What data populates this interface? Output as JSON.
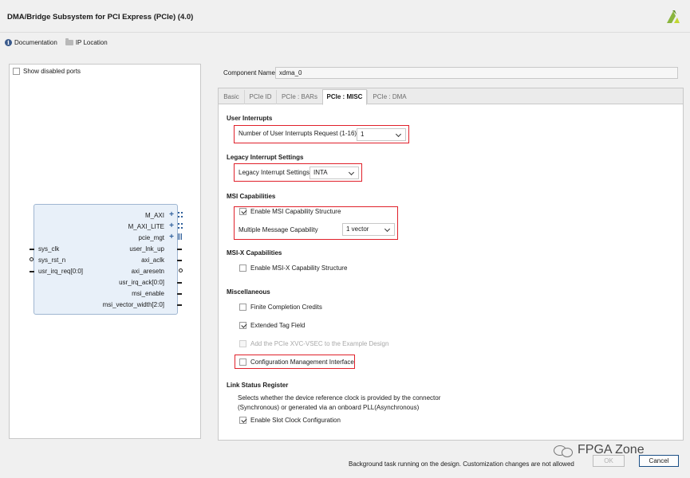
{
  "window": {
    "title": "DMA/Bridge Subsystem for PCI Express (PCIe) (4.0)",
    "logo_icon": "xilinx-logo-icon"
  },
  "links": {
    "documentation": "Documentation",
    "ip_location": "IP Location"
  },
  "left_panel": {
    "show_disabled_ports": "Show disabled ports",
    "right_ports": [
      "M_AXI",
      "M_AXI_LITE",
      "pcie_mgt",
      "user_lnk_up",
      "axi_aclk",
      "axi_aresetn",
      "usr_irq_ack[0:0]",
      "msi_enable",
      "msi_vector_width[2:0]"
    ],
    "left_ports": [
      "sys_clk",
      "sys_rst_n",
      "usr_irq_req[0:0]"
    ]
  },
  "component": {
    "label": "Component Name",
    "value": "xdma_0"
  },
  "tabs": [
    {
      "label": "Basic"
    },
    {
      "label": "PCIe ID"
    },
    {
      "label": "PCIe : BARs"
    },
    {
      "label": "PCIe : MISC",
      "active": true
    },
    {
      "label": "PCIe : DMA"
    }
  ],
  "misc": {
    "user_interrupts": {
      "heading": "User Interrupts",
      "label": "Number of User Interrupts Request (1-16)",
      "value": "1"
    },
    "legacy": {
      "heading": "Legacy Interrupt Settings",
      "label": "Legacy Interrupt Settings",
      "value": "INTA"
    },
    "msi": {
      "heading": "MSI Capabilities",
      "enable_label": "Enable MSI Capability Structure",
      "enable_checked": true,
      "mmc_label": "Multiple Message Capability",
      "mmc_value": "1 vector"
    },
    "msix": {
      "heading": "MSI-X Capabilities",
      "enable_label": "Enable MSI-X Capability Structure",
      "enable_checked": false
    },
    "misc_section": {
      "heading": "Miscellaneous",
      "finite_label": "Finite Completion Credits",
      "finite_checked": false,
      "ext_tag_label": "Extended Tag Field",
      "ext_tag_checked": true,
      "xvc_label": "Add the PCIe XVC-VSEC to the Example Design",
      "xvc_checked": false,
      "cfg_mgmt_label": "Configuration Management Interface",
      "cfg_mgmt_checked": false
    },
    "link_status": {
      "heading": "Link Status Register",
      "desc_line1": "Selects whether the device reference clock is provided by the connector",
      "desc_line2": "(Synchronous) or generated via an onboard PLL(Asynchronous)",
      "slot_clock_label": "Enable Slot Clock Configuration",
      "slot_clock_checked": true
    }
  },
  "footer": {
    "status": "Background task running on the design. Customization changes are not allowed",
    "ok": "OK",
    "cancel": "Cancel"
  },
  "watermark": {
    "text": "FPGA Zone"
  },
  "colors": {
    "highlight_box": "#e0202a",
    "ip_block_fill": "#e8f0f9",
    "bus_blue": "#2f5f9b"
  }
}
